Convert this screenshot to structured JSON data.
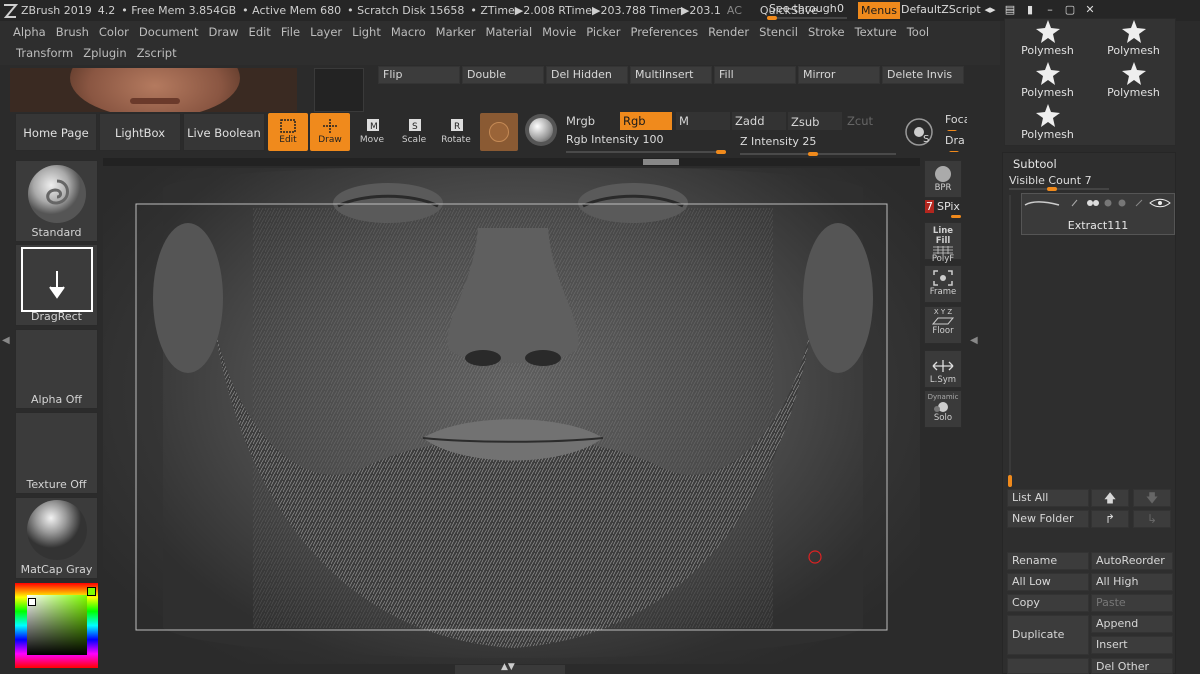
{
  "titlebar": {
    "app": "ZBrush 2019",
    "version": "4.2",
    "free_mem": "• Free Mem 3.854GB",
    "active_mem": "• Active Mem 680",
    "scratch": "• Scratch Disk 15658",
    "ztime": "• ZTime▶2.008 RTime▶203.788 Timer▶203.1",
    "ac": "AC",
    "quicksave": "QuickSave",
    "seethrough_label": "See-through",
    "seethrough_value": "0",
    "menus": "Menus",
    "default_script": "DefaultZScript"
  },
  "menubar": {
    "row1": [
      "Alpha",
      "Brush",
      "Color",
      "Document",
      "Draw",
      "Edit",
      "File",
      "Layer",
      "Light",
      "Macro",
      "Marker",
      "Material",
      "Movie",
      "Picker",
      "Preferences",
      "Render",
      "Stencil",
      "Stroke",
      "Texture",
      "Tool"
    ],
    "row2": [
      "Transform",
      "Zplugin",
      "Zscript"
    ]
  },
  "top_buttons": [
    "Flip",
    "Double",
    "Del Hidden",
    "MultiInsert",
    "Fill",
    "Mirror",
    "Delete Invis"
  ],
  "nav": {
    "home": "Home Page",
    "lightbox": "LightBox",
    "live_boolean": "Live Boolean"
  },
  "tools": {
    "edit": "Edit",
    "draw": "Draw",
    "move": "Move",
    "scale": "Scale",
    "rotate": "Rotate"
  },
  "color_mode": {
    "mrgb": "Mrgb",
    "rgb": "Rgb",
    "m": "M",
    "rgb_intensity_label": "Rgb Intensity",
    "rgb_intensity": "100",
    "zadd": "Zadd",
    "zsub": "Zsub",
    "zcut": "Zcut",
    "z_intensity_label": "Z Intensity",
    "z_intensity": "25",
    "focal": "Foca",
    "draw_size": "Dra"
  },
  "left_shelf": {
    "brush": "Standard",
    "stroke": "DragRect",
    "alpha": "Alpha Off",
    "texture": "Texture Off",
    "material": "MatCap Gray"
  },
  "right_tools": {
    "bpr": "BPR",
    "spix_value": "7",
    "spix_label": "SPix",
    "linefill": "Line Fill",
    "polyf": "PolyF",
    "frame": "Frame",
    "xyz": "X Y Z",
    "floor": "Floor",
    "lsym": "L.Sym",
    "dynamic": "Dynamic",
    "solo": "Solo"
  },
  "polymesh_grid": [
    "Polymesh",
    "Polymesh",
    "Polymesh",
    "Polymesh",
    "Polymesh"
  ],
  "subtool": {
    "title": "Subtool",
    "visible_count_label": "Visible Count",
    "visible_count": "7",
    "item_name": "Extract111",
    "list_all": "List All",
    "new_folder": "New Folder",
    "rename": "Rename",
    "auto_reorder": "AutoReorder",
    "all_low": "All Low",
    "all_high": "All High",
    "copy": "Copy",
    "paste": "Paste",
    "duplicate": "Duplicate",
    "append": "Append",
    "insert": "Insert",
    "del_other": "Del Other"
  },
  "colors": {
    "accent": "#f08a1c",
    "panel": "#2e2e2e",
    "button": "#3c3c3c"
  }
}
